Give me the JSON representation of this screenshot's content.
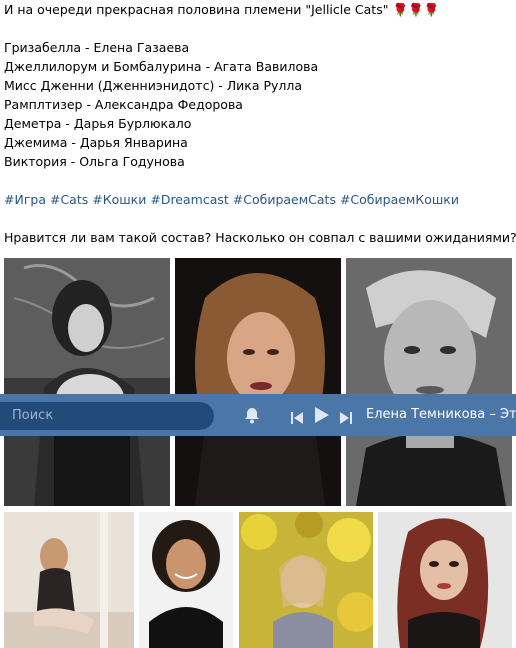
{
  "post": {
    "intro": "И на очереди прекрасная половина племени \"Jellicle Cats\"",
    "intro_emoji": "🌹🌹🌹",
    "cast": [
      "Гризабелла - Елена Газаева",
      "Джеллилорум и Бомбалурина - Агата Вавилова",
      "Мисс Дженни (Дженниэнидотс) - Лика Рулла",
      "Рамплтизер - Александра Федорова",
      "Деметра - Дарья Бурлюкало",
      "Джемима - Дарья Январина",
      "Виктория - Ольга Годунова"
    ],
    "hashtags": [
      "#Игра",
      "#Cats",
      "#Кошки",
      "#Dreamcast",
      "#СобираемCats",
      "#СобираемКошки"
    ],
    "question": "Нравится ли вам такой состав? Насколько он совпал с вашими ожиданиями?"
  },
  "player": {
    "search_placeholder": "Поиск",
    "now_playing": "Елена Темникова – Это п",
    "icons": [
      "bell-icon",
      "prev-track-icon",
      "play-icon",
      "next-track-icon"
    ],
    "accent": "#4a76a8",
    "search_bg": "#224b7a"
  },
  "colors": {
    "hashtag": "#2a5885",
    "rose": "#d0182b"
  },
  "photos": [
    "photo-woman-black-white-1",
    "photo-woman-portrait-dark",
    "photo-woman-black-white-short-hair",
    "photo-woman-sitting-floor",
    "photo-woman-curly-hair",
    "photo-girl-yellow-leaves",
    "photo-woman-red-hair"
  ]
}
